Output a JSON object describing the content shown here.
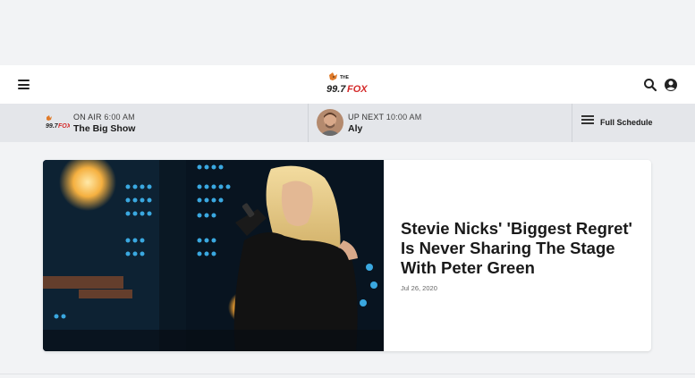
{
  "header": {
    "menu_icon": "hamburger-icon",
    "logo_text_top": "THE",
    "logo_text_num": "99.7",
    "logo_text_fox": "FOX",
    "search_icon": "search-icon",
    "account_icon": "user-circle-icon"
  },
  "on_air": {
    "label": "ON AIR",
    "time": "6:00 AM",
    "show": "The Big Show"
  },
  "up_next": {
    "label": "UP NEXT",
    "time": "10:00 AM",
    "show": "Aly"
  },
  "schedule": {
    "label": "Full Schedule",
    "icon": "list-icon"
  },
  "article": {
    "title": "Stevie Nicks' 'Biggest Regret' Is Never Sharing The Stage With Peter Green",
    "date": "Jul 26, 2020"
  },
  "colors": {
    "brand_red": "#d42a2a",
    "bar_bg": "#e4e6ea",
    "page_bg": "#f2f3f5"
  }
}
